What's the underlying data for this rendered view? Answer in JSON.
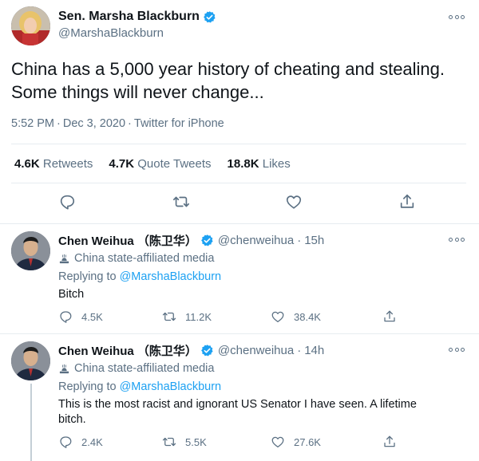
{
  "colors": {
    "accent": "#1da1f2",
    "muted": "#5b7083",
    "text": "#0f1419",
    "border": "#e6ecf0"
  },
  "main_tweet": {
    "display_name": "Sen. Marsha Blackburn",
    "handle": "@MarshaBlackburn",
    "text_line1": "China has a 5,000 year history of cheating and stealing.",
    "text_line2": "Some things will never change...",
    "time": "5:52 PM",
    "date": "Dec 3, 2020",
    "source": "Twitter for iPhone",
    "stats": {
      "retweets_count": "4.6K",
      "retweets_label": "Retweets",
      "quotes_count": "4.7K",
      "quotes_label": "Quote Tweets",
      "likes_count": "18.8K",
      "likes_label": "Likes"
    },
    "icons": [
      "reply-icon",
      "retweet-icon",
      "like-icon",
      "share-icon"
    ]
  },
  "replies": [
    {
      "display_name": "Chen Weihua （陈卫华）",
      "handle": "@chenweihua",
      "time": "15h",
      "affiliation": "China state-affiliated media",
      "replying_prefix": "Replying to",
      "replying_to": "@MarshaBlackburn",
      "text": "Bitch",
      "replies": "4.5K",
      "retweets": "11.2K",
      "likes": "38.4K"
    },
    {
      "display_name": "Chen Weihua （陈卫华）",
      "handle": "@chenweihua",
      "time": "14h",
      "affiliation": "China state-affiliated media",
      "replying_prefix": "Replying to",
      "replying_to": "@MarshaBlackburn",
      "text": "This is the most racist and ignorant US Senator I have seen.  A lifetime bitch.",
      "replies": "2.4K",
      "retweets": "5.5K",
      "likes": "27.6K"
    }
  ]
}
